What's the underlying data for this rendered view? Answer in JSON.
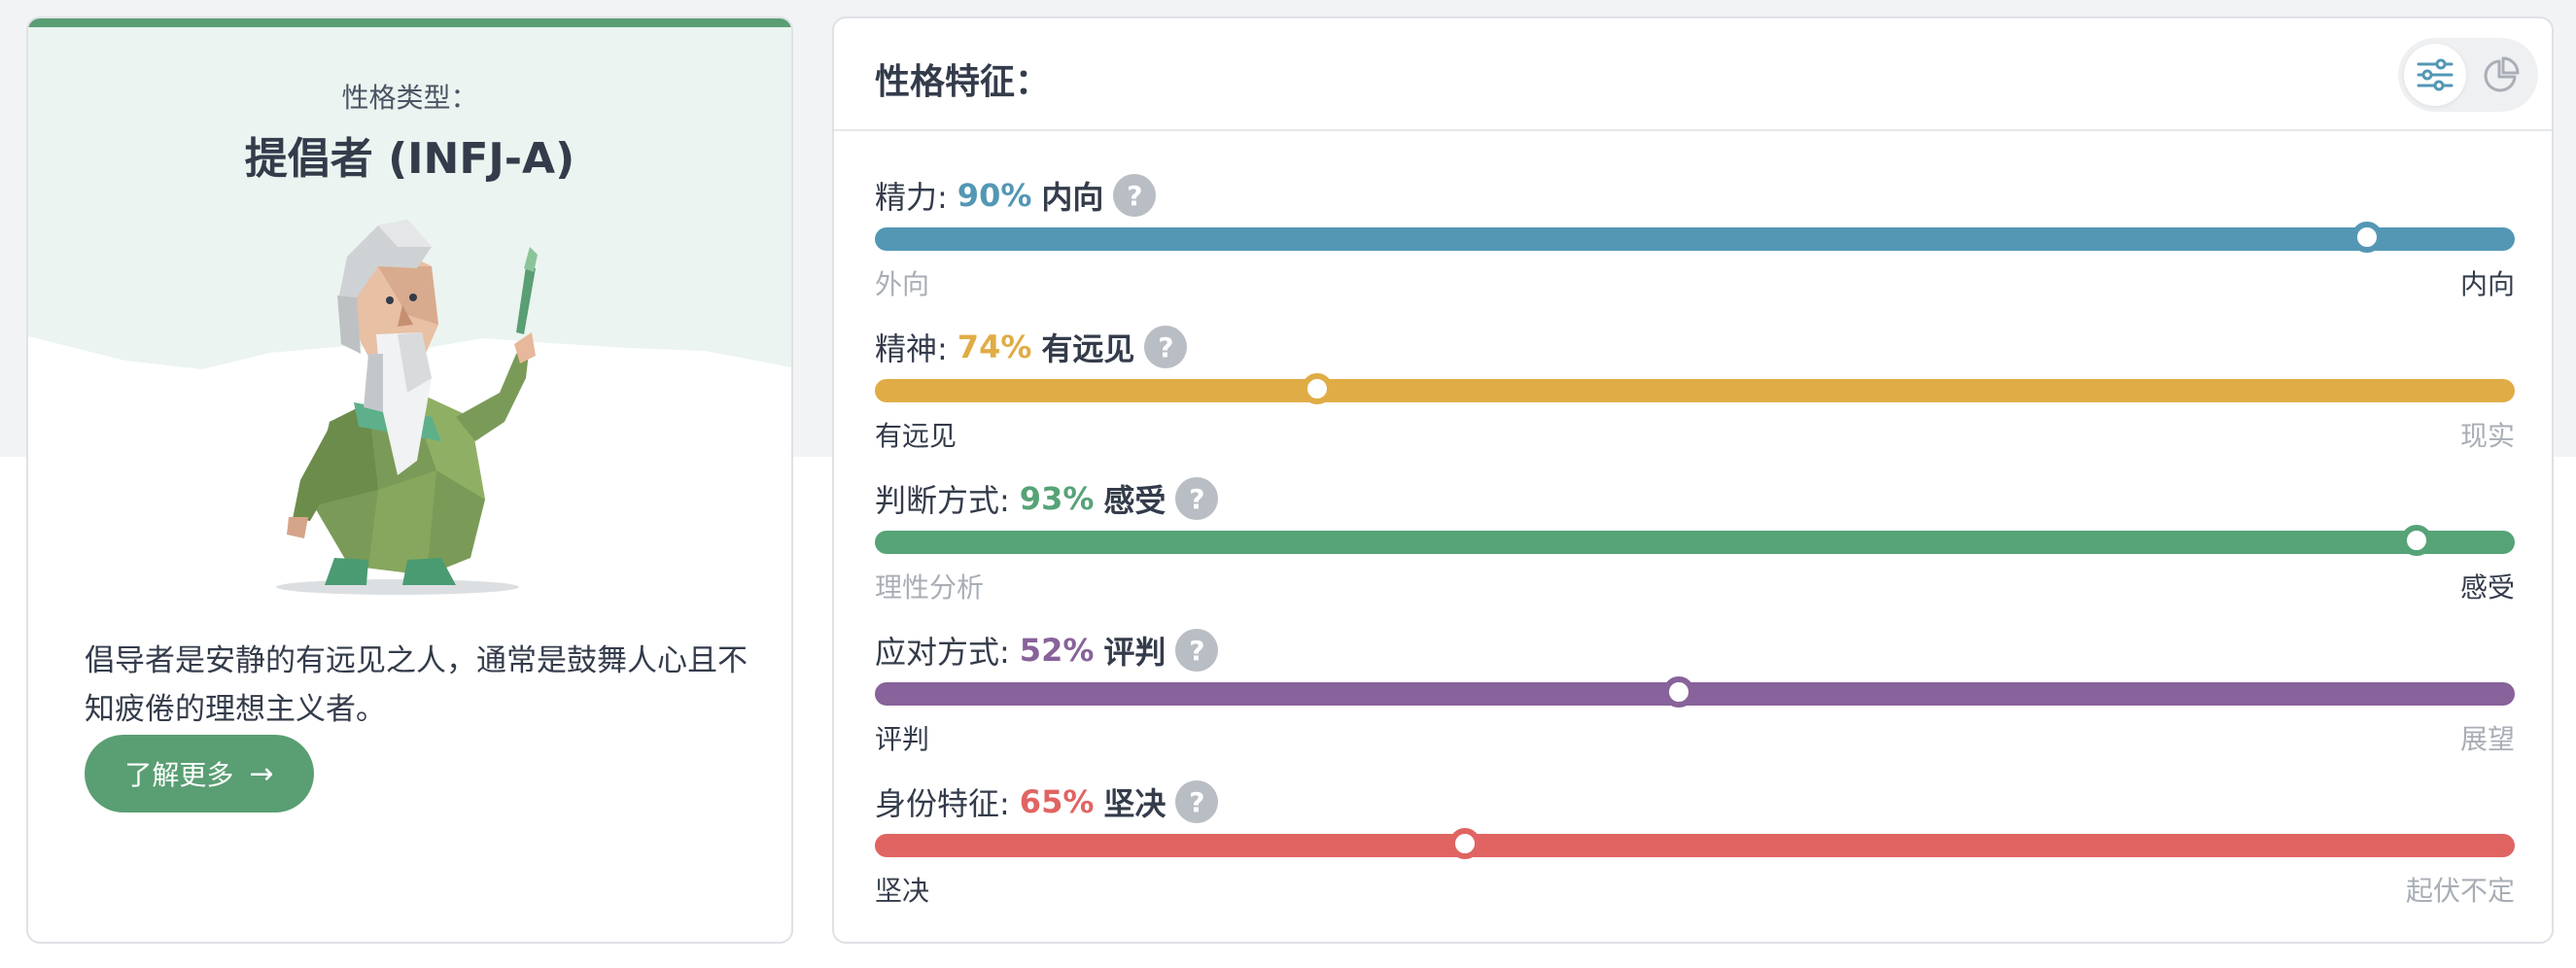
{
  "type_card": {
    "label": "性格类型：",
    "name": "提倡者 (INFJ-A)",
    "description": "倡导者是安静的有远见之人，通常是鼓舞人心且不知疲倦的理想主义者。",
    "button_label": "了解更多",
    "accent_color": "#5a9e74",
    "figure": "wizard-illustration"
  },
  "traits_panel": {
    "title": "性格特征：",
    "view_toggle": [
      "sliders-icon",
      "pie-chart-icon"
    ],
    "active_view": "sliders",
    "traits": [
      {
        "name": "精力:",
        "percent": "90%",
        "pole": "内向",
        "value": 0.91,
        "color": "#5397b5",
        "left_label": "外向",
        "right_label": "内向",
        "winning_side": "right"
      },
      {
        "name": "精神:",
        "percent": "74%",
        "pole": "有远见",
        "value": 0.27,
        "color": "#e0ac45",
        "left_label": "有远见",
        "right_label": "现实",
        "winning_side": "left"
      },
      {
        "name": "判断方式:",
        "percent": "93%",
        "pole": "感受",
        "value": 0.94,
        "color": "#56a377",
        "left_label": "理性分析",
        "right_label": "感受",
        "winning_side": "right"
      },
      {
        "name": "应对方式:",
        "percent": "52%",
        "pole": "评判",
        "value": 0.49,
        "color": "#88629a",
        "left_label": "评判",
        "right_label": "展望",
        "winning_side": "left"
      },
      {
        "name": "身份特征:",
        "percent": "65%",
        "pole": "坚决",
        "value": 0.36,
        "color": "#e06462",
        "left_label": "坚决",
        "right_label": "起伏不定",
        "winning_side": "left"
      }
    ]
  }
}
